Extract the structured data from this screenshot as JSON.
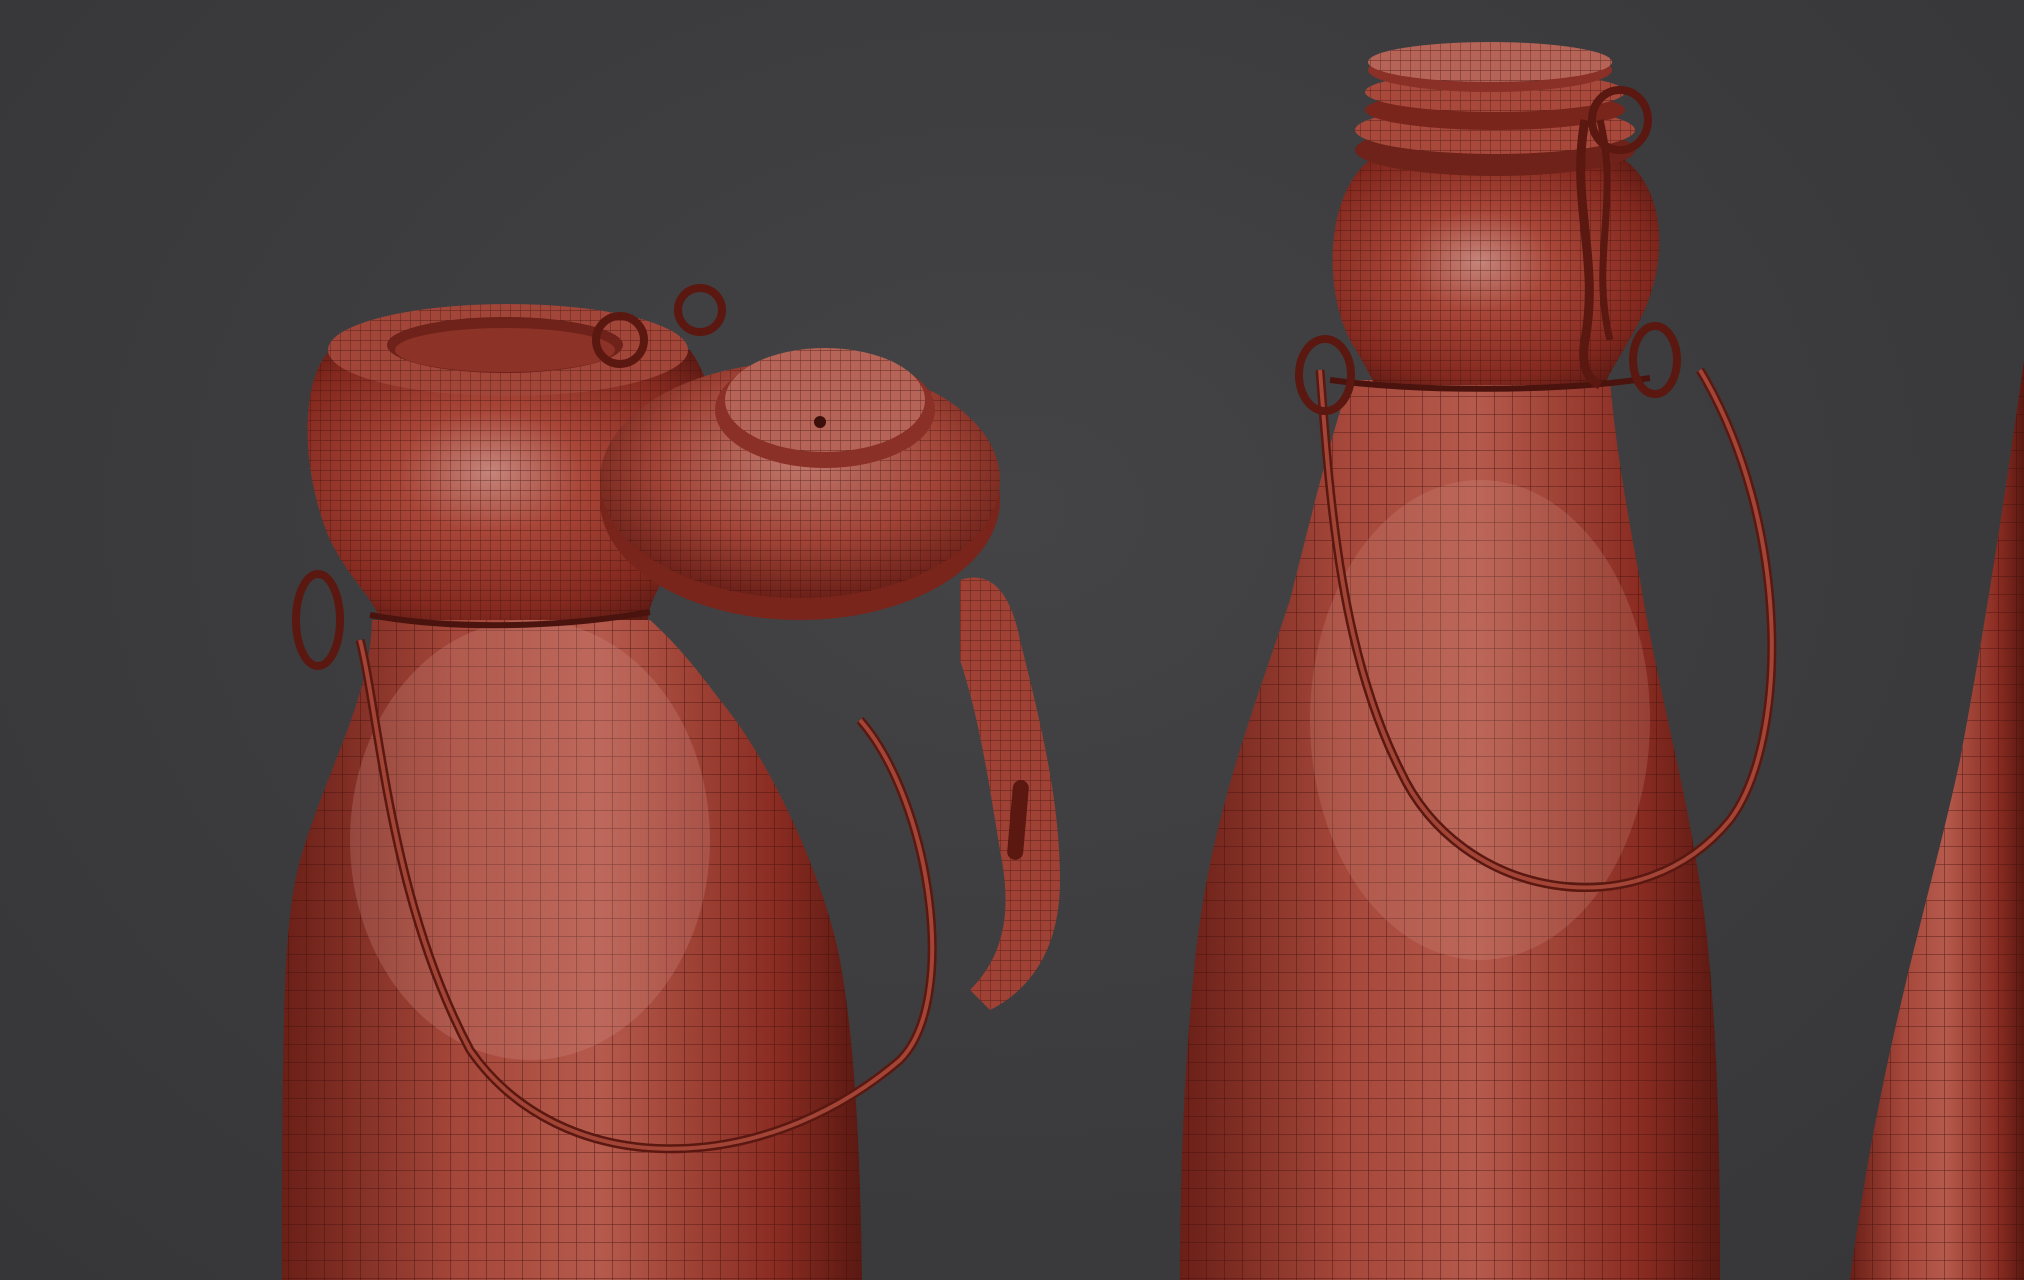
{
  "scene": {
    "background_color": "#3d3d3f",
    "mesh_color": "#9a3a2e",
    "mesh_highlight_color": "#c7786e",
    "wire_color": "#4a130e",
    "objects": [
      {
        "name": "open-swing-top-bottle",
        "state": "lid open"
      },
      {
        "name": "closed-swing-top-bottle",
        "state": "lid closed"
      },
      {
        "name": "third-bottle-partial",
        "state": "cropped at right edge"
      }
    ]
  }
}
